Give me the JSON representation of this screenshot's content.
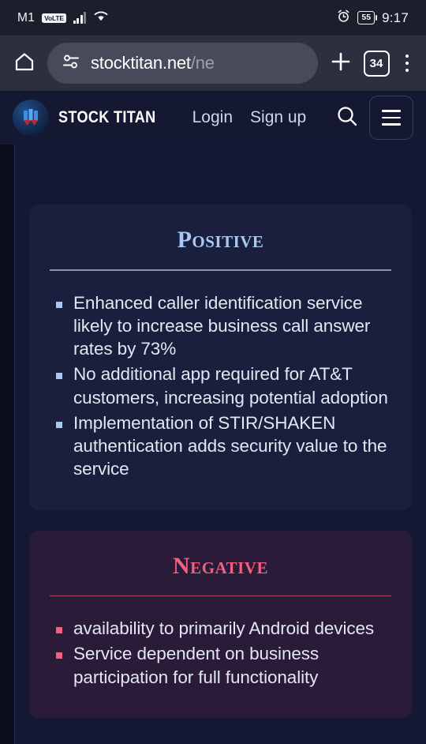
{
  "status_bar": {
    "carrier": "M1",
    "network_badge": "VoLTE",
    "signal_icon": "signal-bars-icon",
    "wifi_icon": "wifi-icon",
    "alarm_icon": "alarm-clock-icon",
    "battery_percent": "55",
    "time": "9:17"
  },
  "browser": {
    "home_icon": "home-icon",
    "site_settings_icon": "page-info-icon",
    "url_visible": "stocktitan.net",
    "url_dim": "/ne",
    "new_tab_icon": "plus-icon",
    "tab_count": "34",
    "menu_icon": "kebab-menu-icon"
  },
  "site_header": {
    "logo_icon": "stock-titan-logo",
    "brand": "STOCK TITAN",
    "login": "Login",
    "signup": "Sign up",
    "search_icon": "search-icon",
    "menu_icon": "hamburger-menu-icon"
  },
  "cards": {
    "positive": {
      "title": "Positive",
      "accent": "#a9c9f2",
      "bullets": [
        "Enhanced caller identification service likely to increase business call answer rates by 73%",
        "No additional app required for AT&T customers, increasing potential adoption",
        "Implementation of STIR/SHAKEN authentication adds security value to the service"
      ]
    },
    "negative": {
      "title": "Negative",
      "accent": "#f2607f",
      "bullets": [
        "availability to primarily Android devices",
        "Service dependent on business participation for full functionality"
      ]
    }
  }
}
